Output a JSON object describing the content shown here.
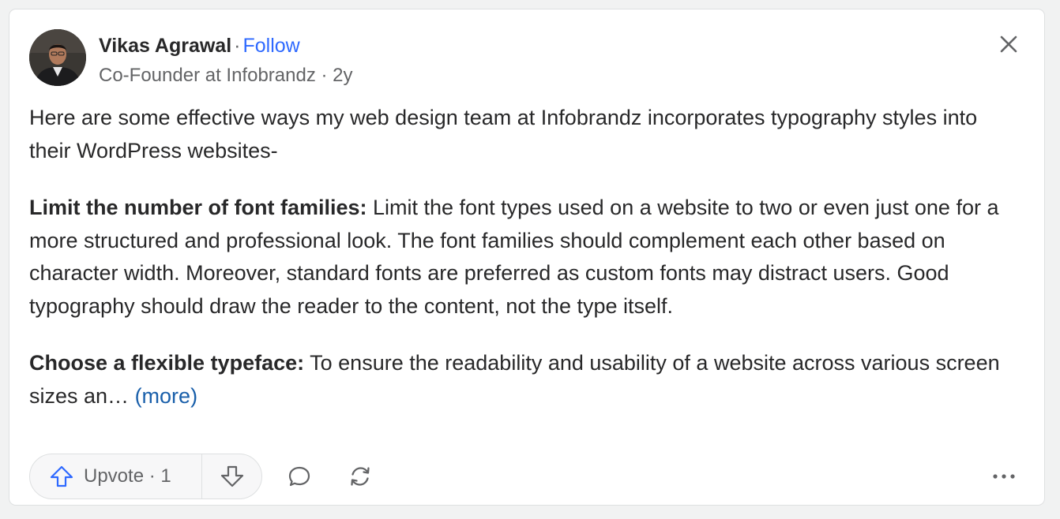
{
  "author": {
    "name": "Vikas Agrawal",
    "separator": "·",
    "follow_label": "Follow",
    "credential": "Co-Founder at Infobrandz · 2y"
  },
  "icons": {
    "close": "close-icon",
    "upvote": "arrow-up-icon",
    "downvote": "arrow-down-icon",
    "comment": "comment-icon",
    "share": "share-icon",
    "more": "more-icon"
  },
  "answer": {
    "intro": "Here are some effective ways my web design team at Infobrandz incorporates typography styles into their WordPress websites-",
    "point1_heading": "Limit the number of font families:",
    "point1_body": " Limit the font types used on a website to two or even just one for a more structured and professional look. The font families should complement each other based on character width. Moreover, standard fonts are preferred as custom fonts may distract users. Good typography should draw the reader to the content, not the type itself.",
    "point2_heading": "Choose a flexible typeface:",
    "point2_body": " To ensure the readability and usability of a website across various screen sizes an… ",
    "more_label": "(more)"
  },
  "actions": {
    "upvote_label": "Upvote · 1"
  },
  "colors": {
    "accent": "#2e69ff",
    "link": "#195faa",
    "text": "#282829",
    "muted": "#636466"
  }
}
